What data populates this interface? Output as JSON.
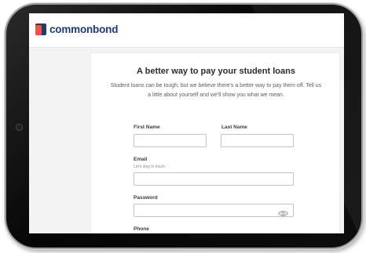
{
  "brand": {
    "name": "commonbond",
    "logo_icon": "commonbond-logo",
    "colors": {
      "navy": "#1f3b70",
      "coral": "#e8574a"
    }
  },
  "form": {
    "title": "A better way to pay your student loans",
    "intro": "Student loans can be tough, but we believe there's a better way to pay them off. Tell us a little about yourself and we'll show you what we mean.",
    "first_name": {
      "label": "First Name",
      "value": "",
      "placeholder": ""
    },
    "last_name": {
      "label": "Last Name",
      "value": "",
      "placeholder": ""
    },
    "email": {
      "label": "Email",
      "hint": "Let's stay in touch.",
      "value": "",
      "placeholder": ""
    },
    "password": {
      "label": "Password",
      "value": "",
      "placeholder": "",
      "toggle_icon": "eye-icon"
    },
    "phone": {
      "label": "Phone"
    }
  }
}
